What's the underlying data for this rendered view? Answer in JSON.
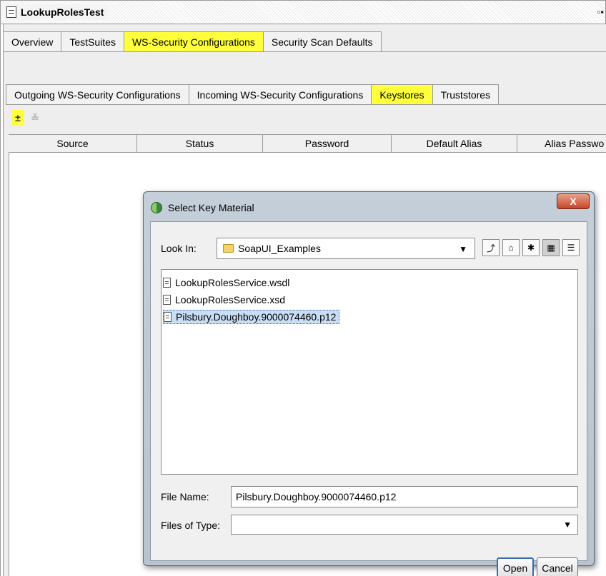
{
  "window": {
    "title": "LookupRolesTest"
  },
  "main_tabs": [
    {
      "label": "Overview"
    },
    {
      "label": "TestSuites"
    },
    {
      "label": "WS-Security Configurations",
      "highlighted": true
    },
    {
      "label": "Security Scan Defaults"
    }
  ],
  "sub_tabs": [
    {
      "label": "Outgoing WS-Security Configurations"
    },
    {
      "label": "Incoming WS-Security Configurations"
    },
    {
      "label": "Keystores",
      "highlighted": true
    },
    {
      "label": "Truststores"
    }
  ],
  "toolbar": {
    "add_icon": "add-keystore-icon",
    "remove_icon": "remove-keystore-icon"
  },
  "table": {
    "columns": [
      "Source",
      "Status",
      "Password",
      "Default Alias",
      "Alias Passwo"
    ]
  },
  "dialog": {
    "title": "Select Key Material",
    "close_label": "X",
    "look_in_label": "Look In:",
    "look_in_value": "SoapUI_Examples",
    "files": [
      {
        "name": "LookupRolesService.wsdl",
        "selected": false
      },
      {
        "name": "LookupRolesService.xsd",
        "selected": false
      },
      {
        "name": "Pilsbury.Doughboy.9000074460.p12",
        "selected": true
      }
    ],
    "file_name_label": "File Name:",
    "file_name_value": "Pilsbury.Doughboy.9000074460.p12",
    "files_of_type_label": "Files of Type:",
    "files_of_type_value": "",
    "open_label": "Open",
    "cancel_label": "Cancel"
  },
  "colors": {
    "highlight": "#ffff3c",
    "selection": "#c9def5",
    "close_button": "#c8452a"
  }
}
